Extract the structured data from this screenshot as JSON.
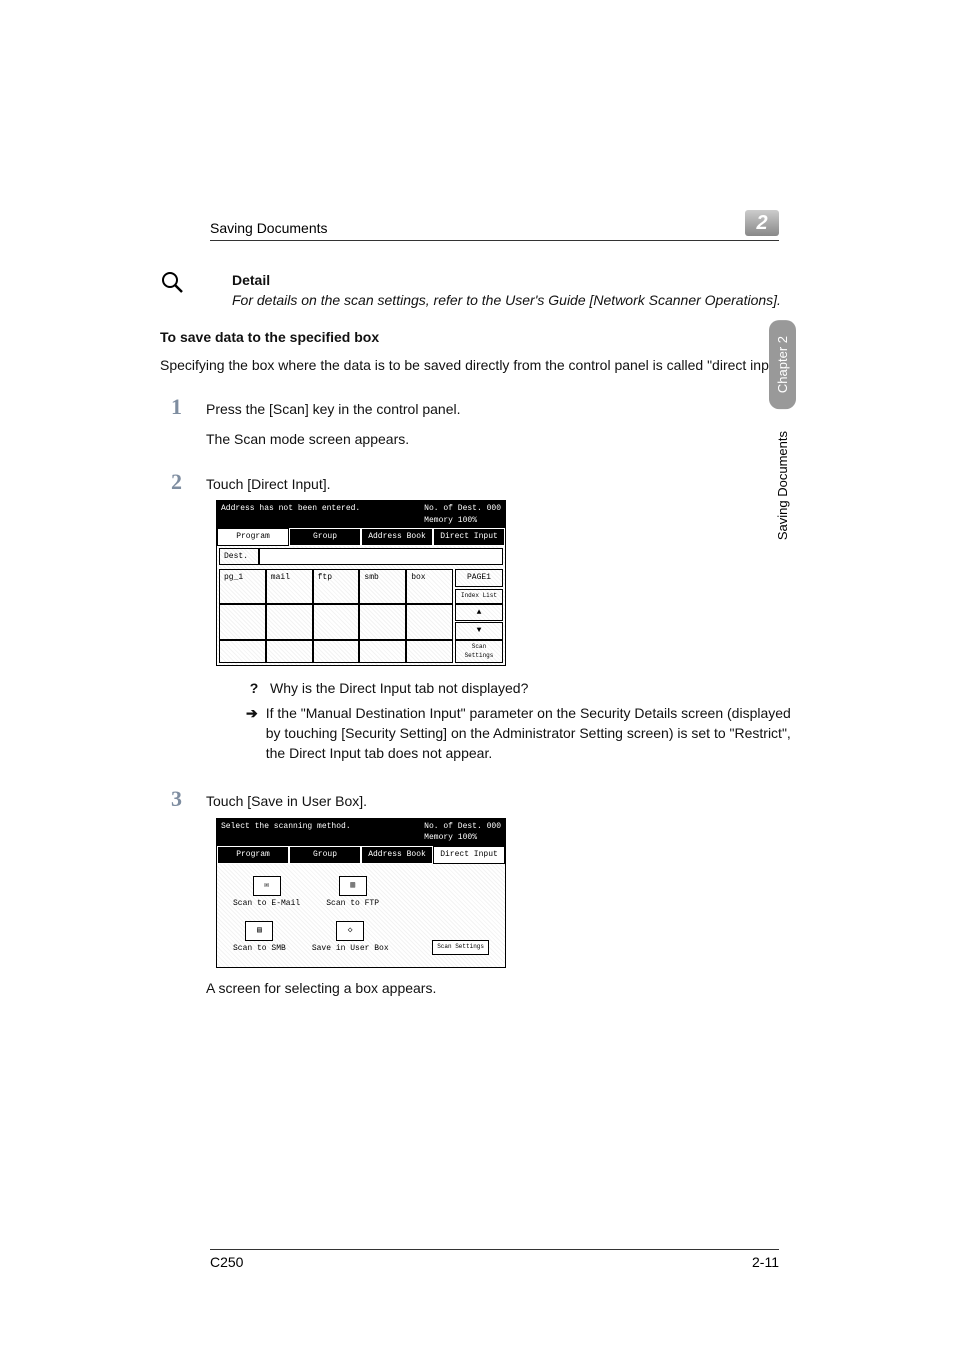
{
  "header": {
    "title": "Saving Documents",
    "chapter_number": "2"
  },
  "side": {
    "chapter_label": "Chapter 2",
    "section_label": "Saving Documents"
  },
  "detail": {
    "heading": "Detail",
    "body": "For details on the scan settings, refer to the User's Guide [Network Scanner Operations]."
  },
  "subheading": "To save data to the specified box",
  "intro": "Specifying the box where the data is to be saved directly from the control panel is called \"direct input\".",
  "steps": {
    "s1": {
      "num": "1",
      "text": "Press the [Scan] key in the control panel.",
      "sub": "The Scan mode screen appears."
    },
    "s2": {
      "num": "2",
      "text": "Touch [Direct Input]."
    },
    "s3": {
      "num": "3",
      "text": "Touch [Save in User Box].",
      "after": "A screen for selecting a box appears."
    }
  },
  "qa": {
    "q": "Why is the Direct Input tab not displayed?",
    "a": "If the \"Manual Destination Input\" parameter on the Security Details screen (displayed by touching [Security Setting] on the Administrator Setting screen) is set to \"Restrict\", the Direct Input tab does not appear."
  },
  "panel1": {
    "status": "Address has not been entered.",
    "dest_count_label": "No. of Dest.",
    "dest_count": "000",
    "memory_label": "Memory",
    "memory_value": "100%",
    "tabs": {
      "program": "Program",
      "group": "Group",
      "address": "Address Book",
      "direct": "Direct Input"
    },
    "dest_label": "Dest.",
    "cells": {
      "pg1": "pg_1",
      "mail": "mail",
      "ftp": "ftp",
      "smb": "smb",
      "box": "box"
    },
    "page_label": "PAGE1",
    "index_label": "Index List",
    "scan_settings": "Scan Settings"
  },
  "panel2": {
    "status": "Select the scanning method.",
    "dest_count_label": "No. of Dest.",
    "dest_count": "000",
    "memory_label": "Memory",
    "memory_value": "100%",
    "tabs": {
      "program": "Program",
      "group": "Group",
      "address": "Address Book",
      "direct": "Direct Input"
    },
    "icons": {
      "email": "Scan to E-Mail",
      "ftp": "Scan to FTP",
      "smb": "Scan to SMB",
      "userbox": "Save in User Box"
    },
    "scan_settings": "Scan Settings"
  },
  "footer": {
    "model": "C250",
    "page": "2-11"
  }
}
